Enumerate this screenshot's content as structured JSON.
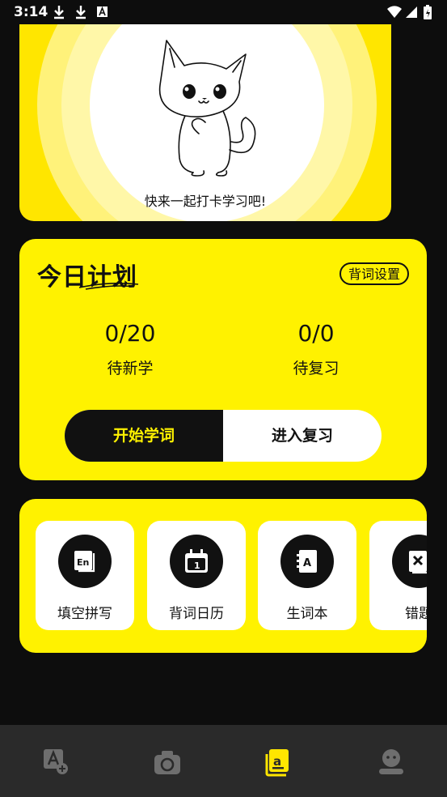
{
  "status_bar": {
    "time": "3:14"
  },
  "hero": {
    "caption": "快来一起打卡学习吧!"
  },
  "plan": {
    "title": "今日计划",
    "settings_label": "背词设置",
    "stats": [
      {
        "value": "0/20",
        "label": "待新学"
      },
      {
        "value": "0/0",
        "label": "待复习"
      }
    ],
    "start_label": "开始学词",
    "review_label": "进入复习"
  },
  "tools": [
    {
      "label": "填空拼写",
      "icon": "en-book-icon"
    },
    {
      "label": "背词日历",
      "icon": "calendar-icon"
    },
    {
      "label": "生词本",
      "icon": "address-book-icon"
    },
    {
      "label": "错题",
      "icon": "error-note-icon"
    }
  ],
  "bottom_nav": [
    {
      "icon": "translate-icon",
      "active": false
    },
    {
      "icon": "camera-icon",
      "active": false
    },
    {
      "icon": "wordbook-icon",
      "active": true
    },
    {
      "icon": "profile-icon",
      "active": false
    }
  ],
  "colors": {
    "accent": "#fff200",
    "dark": "#111111",
    "nav_bg": "#2a2a2a"
  }
}
